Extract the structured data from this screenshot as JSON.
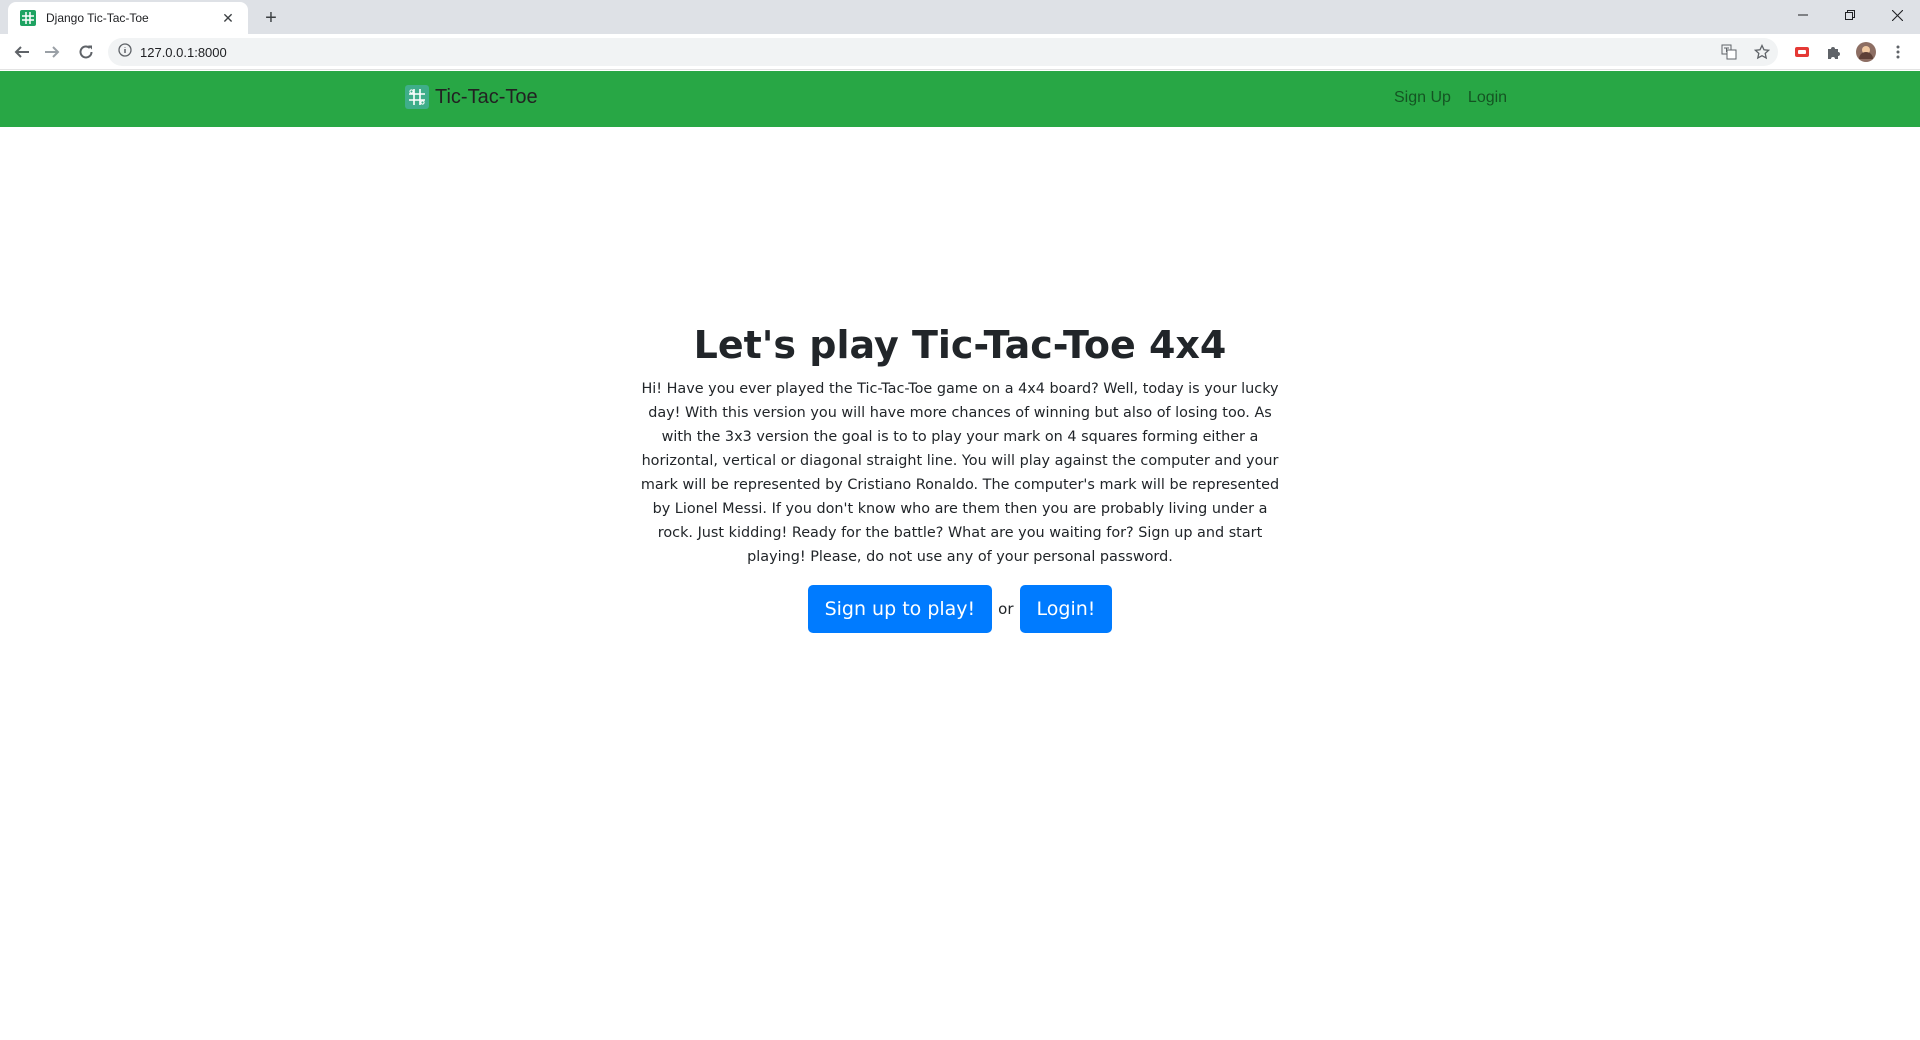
{
  "browser": {
    "tab_title": "Django Tic-Tac-Toe",
    "url": "127.0.0.1:8000"
  },
  "navbar": {
    "brand": "Tic-Tac-Toe",
    "links": [
      "Sign Up",
      "Login"
    ],
    "color": "#28a745"
  },
  "hero": {
    "title": "Let's play Tic-Tac-Toe 4x4",
    "description": "Hi! Have you ever played the Tic-Tac-Toe game on a 4x4 board? Well, today is your lucky day! With this version you will have more chances of winning but also of losing too. As with the 3x3 version the goal is to to play your mark on 4 squares forming either a horizontal, vertical or diagonal straight line. You will play against the computer and your mark will be represented by Cristiano Ronaldo. The computer's mark will be represented by Lionel Messi. If you don't know who are them then you are probably living under a rock. Just kidding! Ready for the battle? What are you waiting for? Sign up and start playing! Please, do not use any of your personal password.",
    "signup_button": "Sign up to play!",
    "or_text": "or",
    "login_button": "Login!",
    "button_color": "#007bff"
  }
}
